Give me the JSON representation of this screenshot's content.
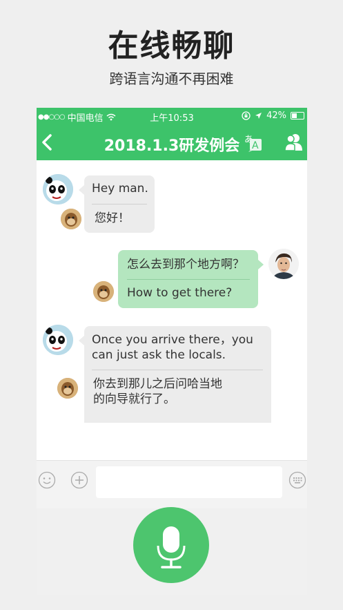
{
  "promo": {
    "title": "在线畅聊",
    "subtitle": "跨语言沟通不再困难"
  },
  "status_bar": {
    "carrier": "中国电信",
    "time": "上午10:53",
    "battery": "42%"
  },
  "nav": {
    "title": "2018.1.3研发例会",
    "translate_icon": "translate-icon",
    "members_icon": "people-icon"
  },
  "messages": [
    {
      "side": "left",
      "original": "Hey man.",
      "translation": "您好！"
    },
    {
      "side": "right",
      "original": "怎么去到那个地方啊？",
      "translation": "How to get there?"
    },
    {
      "side": "left",
      "original_lines": [
        "Once you arrive there，you",
        "can just ask the locals."
      ],
      "translation_lines": [
        "你去到那儿之后问哈当地",
        "的向导就行了。"
      ]
    }
  ],
  "colors": {
    "accent": "#3dc36a",
    "bubble_in": "#ececec",
    "bubble_out": "#b4e6bf",
    "mic": "#4dc56e"
  }
}
